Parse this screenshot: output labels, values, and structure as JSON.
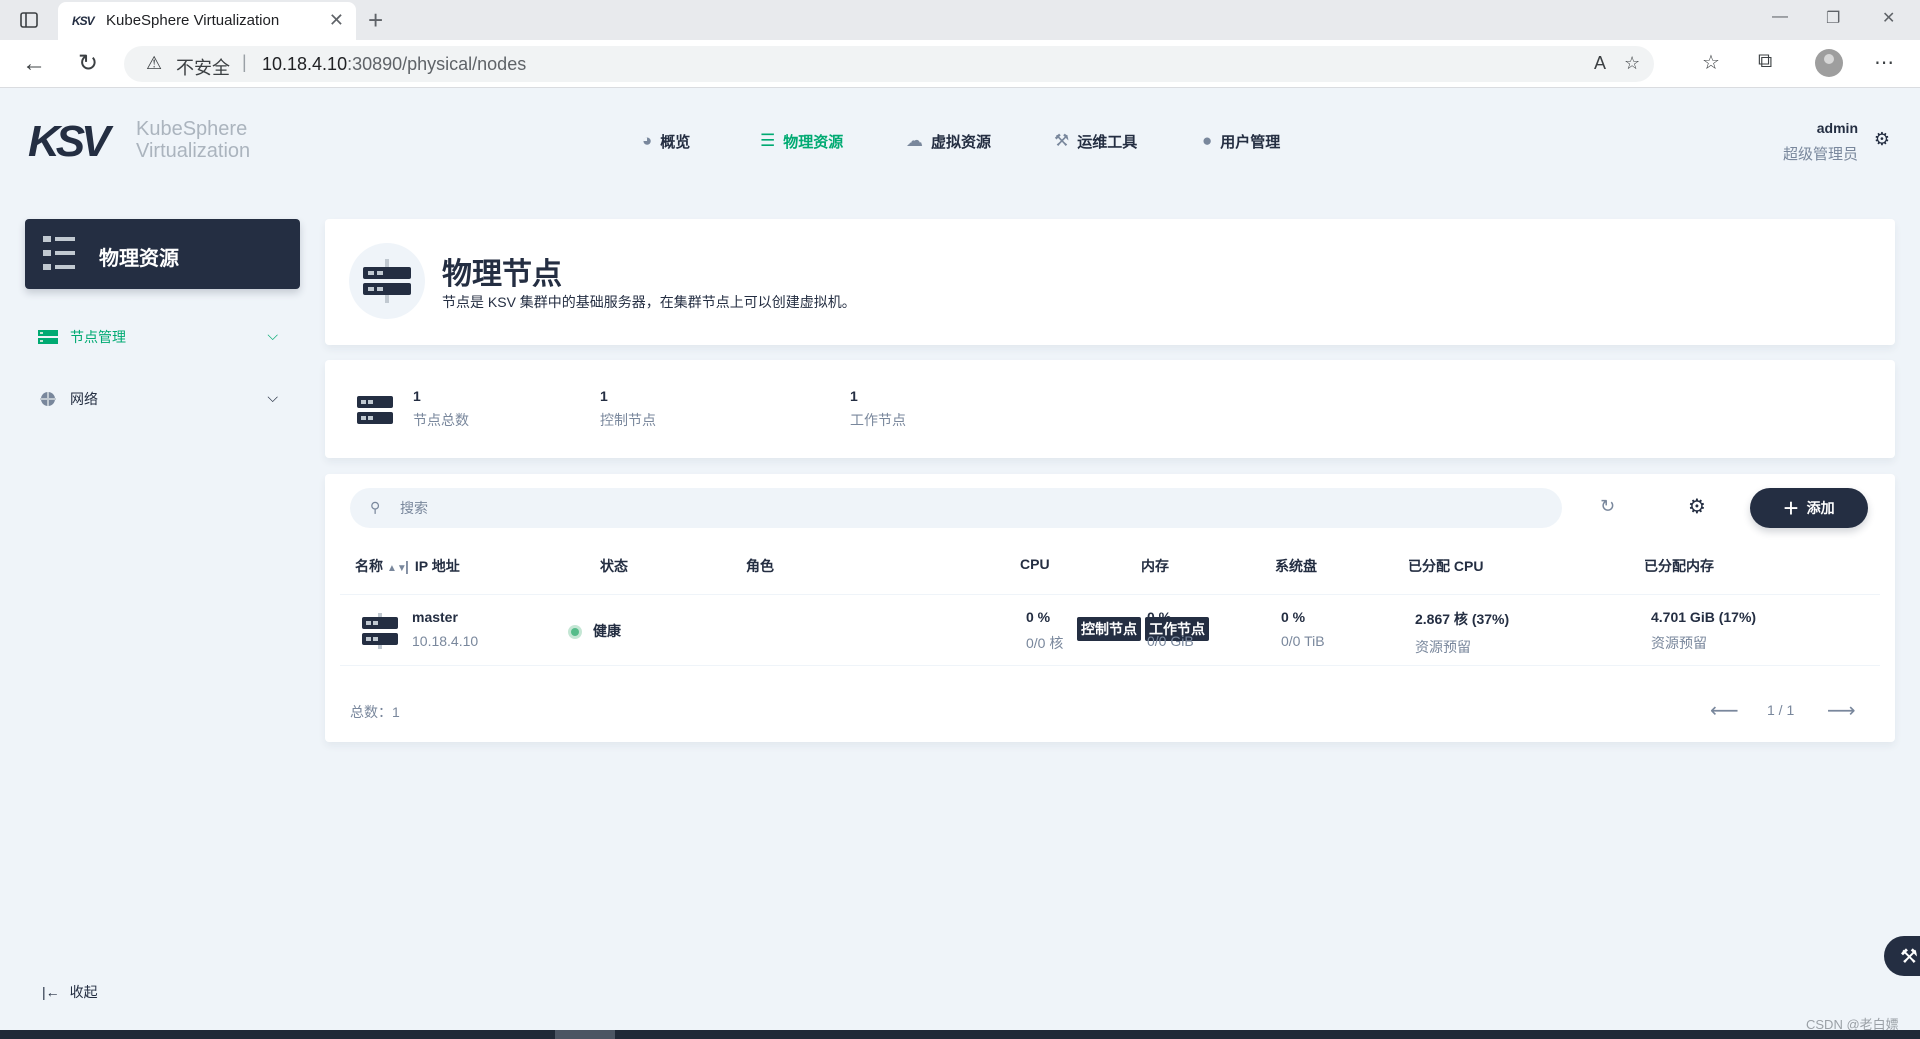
{
  "browser": {
    "tab_title": "KubeSphere Virtualization",
    "tab_favicon": "KSV",
    "new_tab": "+",
    "insecure_label": "不安全",
    "url_host": "10.18.4.10",
    "url_rest": ":30890/physical/nodes"
  },
  "header": {
    "logo": "KSV",
    "logo_line1": "KubeSphere",
    "logo_line2": "Virtualization",
    "nav": [
      {
        "label": "概览",
        "icon": "dashboard-icon"
      },
      {
        "label": "物理资源",
        "icon": "list-icon"
      },
      {
        "label": "虚拟资源",
        "icon": "cloud-icon"
      },
      {
        "label": "运维工具",
        "icon": "hammer-icon"
      },
      {
        "label": "用户管理",
        "icon": "user-icon"
      }
    ],
    "active_nav": "物理资源",
    "user_name": "admin",
    "user_role": "超级管理员"
  },
  "sidebar": {
    "title": "物理资源",
    "items": [
      {
        "label": "节点管理",
        "icon": "server-icon",
        "active": true
      },
      {
        "label": "网络",
        "icon": "network-icon",
        "active": false
      }
    ],
    "collapse_label": "收起"
  },
  "banner": {
    "title": "物理节点",
    "description": "节点是 KSV 集群中的基础服务器，在集群节点上可以创建虚拟机。"
  },
  "stats": [
    {
      "value": "1",
      "label": "节点总数"
    },
    {
      "value": "1",
      "label": "控制节点"
    },
    {
      "value": "1",
      "label": "工作节点"
    }
  ],
  "toolbar": {
    "search_placeholder": "搜索",
    "add_label": "添加"
  },
  "table": {
    "columns": [
      "名称",
      "IP 地址",
      "状态",
      "角色",
      "CPU",
      "内存",
      "系统盘",
      "已分配 CPU",
      "已分配内存"
    ],
    "rows": [
      {
        "name": "master",
        "ip": "10.18.4.10",
        "status": "健康",
        "roles": [
          "控制节点",
          "工作节点"
        ],
        "cpu": "0 %",
        "cpu_detail": "0/0 核",
        "memory": "0 %",
        "memory_detail": "0/0 GiB",
        "disk": "0 %",
        "disk_detail": "0/0 TiB",
        "alloc_cpu": "2.867 核  (37%)",
        "alloc_cpu_detail": "资源预留",
        "alloc_mem": "4.701 GiB  (17%)",
        "alloc_mem_detail": "资源预留"
      }
    ],
    "total_label": "总数：1",
    "page": "1 / 1"
  },
  "watermark": "CSDN @老白嫖",
  "colors": {
    "accent": "#00aa72",
    "dark": "#242e42",
    "muted": "#79879c",
    "background": "#eff4f9",
    "healthy": "#55bc8a"
  }
}
